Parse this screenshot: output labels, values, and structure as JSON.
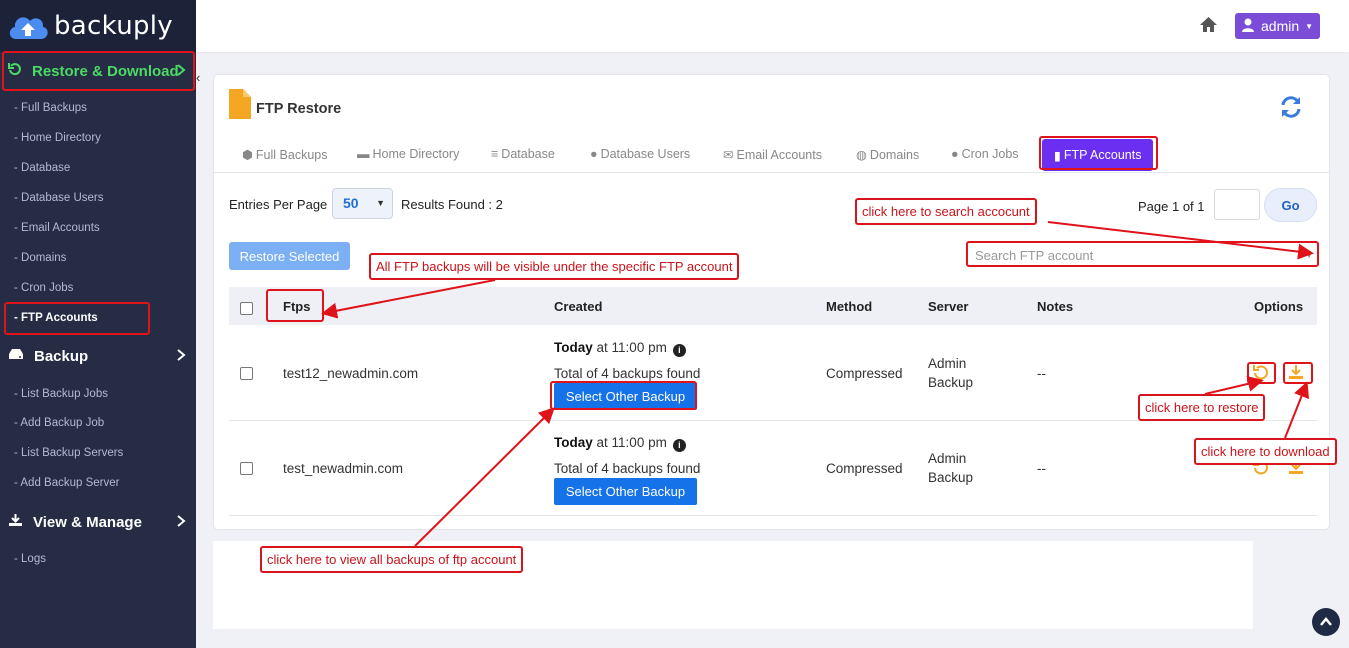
{
  "app": {
    "logo_text": "backuply"
  },
  "sidebar": {
    "restore_header": "Restore & Download",
    "restore_items": [
      "- Full Backups",
      "- Home Directory",
      "- Database",
      "- Database Users",
      "- Email Accounts",
      "- Domains",
      "- Cron Jobs",
      "- FTP Accounts"
    ],
    "backup_header": "Backup",
    "backup_items": [
      "- List Backup Jobs",
      "- Add Backup Job",
      "- List Backup Servers",
      "- Add Backup Server"
    ],
    "view_header": "View & Manage",
    "view_items": [
      "- Logs"
    ],
    "collapse_glyph": "‹"
  },
  "topbar": {
    "user_label": "admin"
  },
  "card": {
    "title": "FTP Restore",
    "tabs": [
      "Full Backups",
      "Home Directory",
      "Database",
      "Database Users",
      "Email Accounts",
      "Domains",
      "Cron Jobs",
      "FTP Accounts"
    ],
    "entries_label": "Entries Per Page",
    "entries_value": "50",
    "results_label": "Results Found : 2",
    "page_label": "Page 1 of 1",
    "go_label": "Go",
    "restore_selected_label": "Restore Selected",
    "search_placeholder": "Search FTP account"
  },
  "table": {
    "headers": {
      "ftps": "Ftps",
      "created": "Created",
      "method": "Method",
      "server": "Server",
      "notes": "Notes",
      "options": "Options"
    },
    "rows": [
      {
        "name": "test12_newadmin.com",
        "today": "Today",
        "time": "at 11:00 pm",
        "found": "Total of 4 backups found",
        "button": "Select Other Backup",
        "method": "Compressed",
        "server_line1": "Admin",
        "server_line2": "Backup",
        "notes": "--"
      },
      {
        "name": "test_newadmin.com",
        "today": "Today",
        "time": "at 11:00 pm",
        "found": "Total of 4 backups found",
        "button": "Select Other Backup",
        "method": "Compressed",
        "server_line1": "Admin",
        "server_line2": "Backup",
        "notes": "--"
      }
    ]
  },
  "annotations": {
    "search": "click here to search accocunt",
    "ftps": "All FTP backups will be visible under the specific FTP account",
    "restore": "click here to restore",
    "download": "click here to download",
    "view_all": "click here to view all backups of ftp account"
  },
  "colors": {
    "sidebar_bg": "#252c44",
    "active_tab": "#6a2ff0",
    "primary_button": "#1572e8",
    "annotation_red": "#d8141c",
    "restore_green": "#4cd964",
    "admin_purple": "#7b4dd6",
    "option_orange": "#f5a623"
  }
}
